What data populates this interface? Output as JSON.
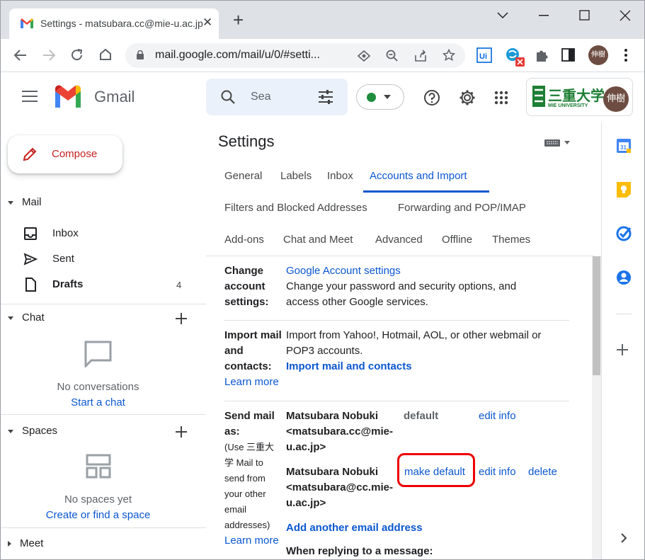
{
  "browser": {
    "tab_title": "Settings - matsubara.cc@mie-u.ac.jp",
    "new_tab": "+",
    "tab_close": "✕",
    "url": "mail.google.com/mail/u/0/#setti..."
  },
  "gmail": {
    "logo_text": "Gmail",
    "search_placeholder": "Sea",
    "avatar_text": "伸樹",
    "university_name": "三重大学",
    "university_sub": "MIE UNIVERSITY"
  },
  "leftnav": {
    "compose": "Compose",
    "mail_section": "Mail",
    "items": [
      {
        "label": "Inbox",
        "count": ""
      },
      {
        "label": "Sent",
        "count": ""
      },
      {
        "label": "Drafts",
        "count": "4"
      }
    ],
    "chat_section": "Chat",
    "chat_empty": "No conversations",
    "chat_link": "Start a chat",
    "spaces_section": "Spaces",
    "spaces_empty": "No spaces yet",
    "spaces_link": "Create or find a space",
    "meet_section": "Meet"
  },
  "settings": {
    "title": "Settings",
    "tabs": [
      {
        "label": "General"
      },
      {
        "label": "Labels"
      },
      {
        "label": "Inbox"
      },
      {
        "label": "Accounts and Import",
        "active": true
      },
      {
        "label": "Filters and Blocked Addresses"
      },
      {
        "label": "Forwarding and POP/IMAP"
      },
      {
        "label": "Add-ons"
      },
      {
        "label": "Chat and Meet"
      },
      {
        "label": "Advanced"
      },
      {
        "label": "Offline"
      },
      {
        "label": "Themes"
      }
    ],
    "change_account": {
      "label_1": "Change",
      "label_2": "account",
      "label_3": "settings:",
      "link": "Google Account settings",
      "desc_1": "Change your password and security options, and",
      "desc_2": "access other Google services."
    },
    "import": {
      "label_1": "Import mail",
      "label_2": "and",
      "label_3": "contacts:",
      "desc_1": "Import from Yahoo!, Hotmail, AOL, or other webmail or",
      "desc_2": "POP3 accounts.",
      "action": "Import mail and contacts",
      "learn_more": "Learn more"
    },
    "send_as": {
      "label_1": "Send mail",
      "label_2": "as:",
      "note_1": "(Use 三重大",
      "note_2": "学 Mail to",
      "note_3": "send from",
      "note_4": "your other",
      "note_5": "email",
      "note_6": "addresses)",
      "learn_more": "Learn more",
      "accounts": [
        {
          "name": "Matsubara Nobuki",
          "email_1": "<matsubara.cc@mie-",
          "email_2": "u.ac.jp>",
          "status": "default",
          "edit": "edit info"
        },
        {
          "name": "Matsubara Nobuki",
          "email_1": "<matsubara@cc.mie-",
          "email_2": "u.ac.jp>",
          "make_default": "make default",
          "edit": "edit info",
          "delete": "delete"
        }
      ],
      "add_another": "Add another email address",
      "when_replying": "When replying to a message:"
    }
  },
  "colors": {
    "accent": "#0b57d0",
    "compose_red": "#c5221f",
    "highlight_box": "#ee0000"
  }
}
